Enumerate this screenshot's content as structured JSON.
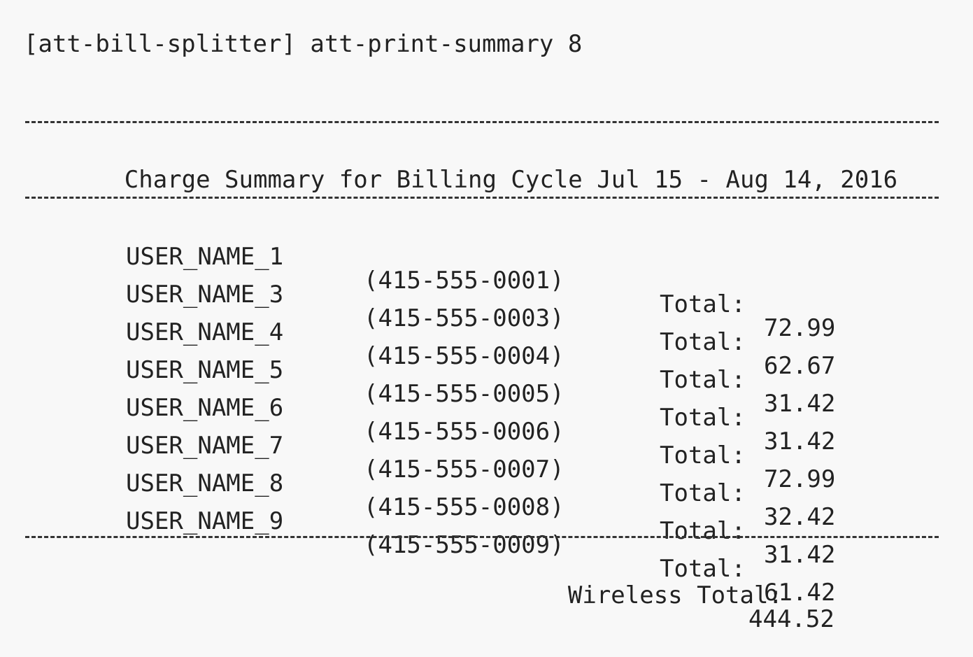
{
  "prompt": {
    "text": "[att-bill-splitter] att-print-summary 8"
  },
  "summary": {
    "title": "Charge Summary for Billing Cycle Jul 15 - Aug 14, 2016",
    "total_label": "Total:",
    "rows": [
      {
        "name": "USER_NAME_1",
        "phone": "(415-555-0001)",
        "total": "72.99"
      },
      {
        "name": "USER_NAME_3",
        "phone": "(415-555-0003)",
        "total": "62.67"
      },
      {
        "name": "USER_NAME_4",
        "phone": "(415-555-0004)",
        "total": "31.42"
      },
      {
        "name": "USER_NAME_5",
        "phone": "(415-555-0005)",
        "total": "31.42"
      },
      {
        "name": "USER_NAME_6",
        "phone": "(415-555-0006)",
        "total": "72.99"
      },
      {
        "name": "USER_NAME_7",
        "phone": "(415-555-0007)",
        "total": "32.42"
      },
      {
        "name": "USER_NAME_8",
        "phone": "(415-555-0008)",
        "total": "31.42"
      },
      {
        "name": "USER_NAME_9",
        "phone": "(415-555-0009)",
        "total": "61.42"
      }
    ],
    "wireless_total_label": "Wireless Total:",
    "wireless_total_value": "444.52"
  },
  "colors": {
    "background": "#f8f8f8",
    "text": "#222222"
  }
}
